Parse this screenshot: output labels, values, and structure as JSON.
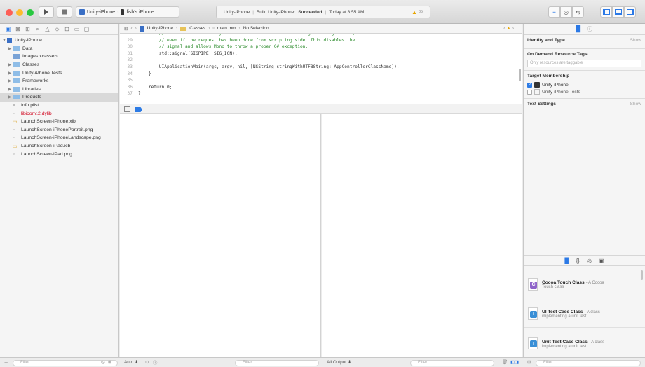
{
  "colors": {
    "close": "#fd5f57",
    "minimize": "#fdbb2e",
    "zoom": "#28c840",
    "accent": "#2d7be5",
    "folder": "#8fbde7",
    "missing_file": "#d0021b",
    "green_comment": "#2a8a2a",
    "keyword": "#b2267d"
  },
  "toolbar": {
    "scheme_target": "Unity-iPhone",
    "scheme_device": "fish's iPhone",
    "status_project": "Unity-iPhone",
    "status_build_prefix": "Build Unity-iPhone:",
    "status_build_result": "Succeeded",
    "status_time": "Today at 8:55 AM",
    "warning_count": "85"
  },
  "navigator": {
    "items": [
      {
        "label": "Unity-iPhone",
        "kind": "project",
        "disclosure": "▼"
      },
      {
        "label": "Data",
        "kind": "folder",
        "disclosure": "▶"
      },
      {
        "label": "Images.xcassets",
        "kind": "assets",
        "disclosure": ""
      },
      {
        "label": "Classes",
        "kind": "folder",
        "disclosure": "▶"
      },
      {
        "label": "Unity-iPhone Tests",
        "kind": "folder",
        "disclosure": "▶"
      },
      {
        "label": "Frameworks",
        "kind": "folder",
        "disclosure": "▶"
      },
      {
        "label": "Libraries",
        "kind": "folder",
        "disclosure": "▶"
      },
      {
        "label": "Products",
        "kind": "folder",
        "disclosure": "▶"
      },
      {
        "label": "Info.plist",
        "kind": "plist",
        "disclosure": ""
      },
      {
        "label": "libiconv.2.dylib",
        "kind": "missing",
        "disclosure": ""
      },
      {
        "label": "LaunchScreen-iPhone.xib",
        "kind": "xib",
        "disclosure": ""
      },
      {
        "label": "LaunchScreen-iPhonePortrait.png",
        "kind": "png",
        "disclosure": ""
      },
      {
        "label": "LaunchScreen-iPhoneLandscape.png",
        "kind": "png",
        "disclosure": ""
      },
      {
        "label": "LaunchScreen-iPad.xib",
        "kind": "xib",
        "disclosure": ""
      },
      {
        "label": "LaunchScreen-iPad.png",
        "kind": "png",
        "disclosure": ""
      }
    ],
    "filter_placeholder": "Filter"
  },
  "jumpbar": {
    "project": "Unity-iPhone",
    "group": "Classes",
    "file": "main.mm",
    "selection": "No Selection"
  },
  "code": {
    "lines": [
      {
        "num": "28",
        "text": "        // The next write to any of such socket causes SIGPIPE signal being raised,",
        "cls": "com"
      },
      {
        "num": "29",
        "text": "        // even if the request has been done from scripting side. This disables the",
        "cls": "com"
      },
      {
        "num": "30",
        "text": "        // signal and allows Mono to throw a proper C# exception.",
        "cls": "com"
      },
      {
        "num": "31",
        "text": "        std::signal(SIGPIPE, SIG_IGN);",
        "cls": "plain"
      },
      {
        "num": "32",
        "text": "",
        "cls": "plain"
      },
      {
        "num": "33",
        "text": "        UIApplicationMain(argc, argv, nil, [NSString stringWithUTF8String: AppControllerClassName]);",
        "cls": "plain"
      },
      {
        "num": "34",
        "text": "    }",
        "cls": "plain"
      },
      {
        "num": "35",
        "text": "",
        "cls": "plain"
      },
      {
        "num": "36",
        "text": "    return 0;",
        "cls": "plain"
      },
      {
        "num": "37",
        "text": "}",
        "cls": "plain"
      }
    ]
  },
  "debug": {
    "auto_label": "Auto",
    "all_output_label": "All Output",
    "filter_placeholder": "Filter"
  },
  "inspector": {
    "identity_header": "Identity and Type",
    "show": "Show",
    "odr_header": "On Demand Resource Tags",
    "odr_placeholder": "Only resources are taggable",
    "target_header": "Target Membership",
    "targets": [
      {
        "label": "Unity-iPhone",
        "checked": true
      },
      {
        "label": "Unity-iPhone Tests",
        "checked": false
      }
    ],
    "text_settings_header": "Text Settings",
    "library_items": [
      {
        "title": "Cocoa Touch Class",
        "desc_inline": "- A Cocoa",
        "desc": "Touch class",
        "letter": "C",
        "color": "#8e63c9"
      },
      {
        "title": "UI Test Case Class",
        "desc_inline": "- A class",
        "desc": "implementing a unit test",
        "letter": "T",
        "color": "#3a8fd6"
      },
      {
        "title": "Unit Test Case Class",
        "desc_inline": "- A class",
        "desc": "implementing a unit test",
        "letter": "T",
        "color": "#3a8fd6"
      }
    ],
    "filter_placeholder": "Filter"
  }
}
